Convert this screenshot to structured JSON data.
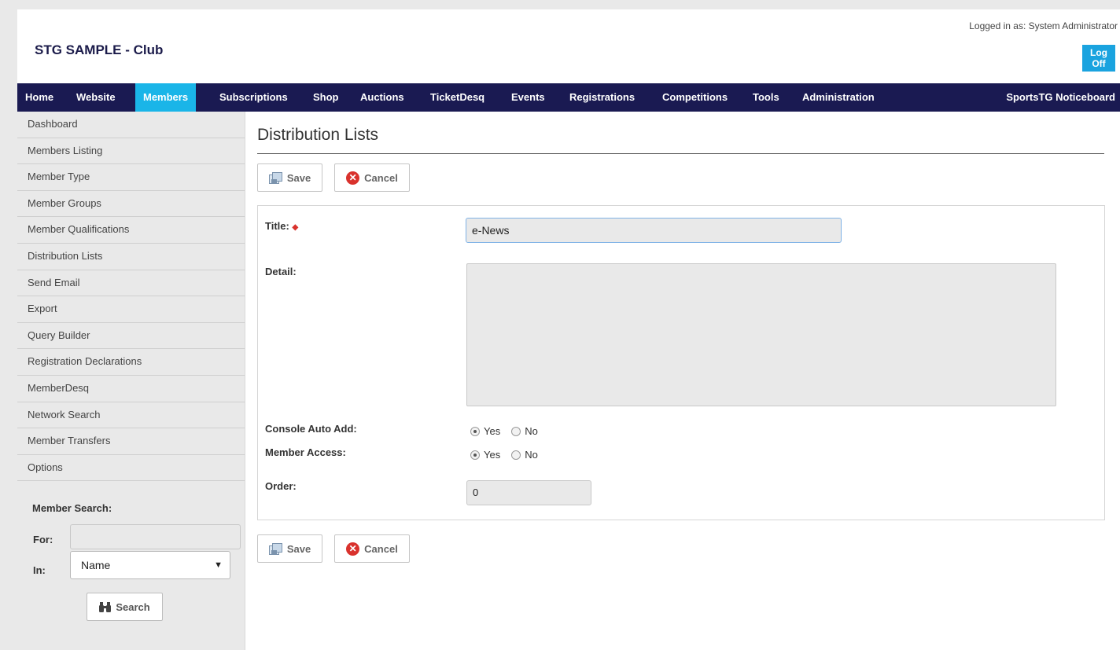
{
  "header": {
    "club_name": "STG SAMPLE - Club",
    "login_text": "Logged in as: System Administrator",
    "logoff_label": "Log Off"
  },
  "nav": {
    "items": [
      "Home",
      "Website",
      "Members",
      "Subscriptions",
      "Shop",
      "Auctions",
      "TicketDesq",
      "Events",
      "Registrations",
      "Competitions",
      "Tools",
      "Administration"
    ],
    "right_item": "SportsTG Noticeboard",
    "active": "Members"
  },
  "sidebar": {
    "items": [
      "Dashboard",
      "Members Listing",
      "Member Type",
      "Member Groups",
      "Member Qualifications",
      "Distribution Lists",
      "Send Email",
      "Export",
      "Query Builder",
      "Registration Declarations",
      "MemberDesq",
      "Network Search",
      "Member Transfers",
      "Options"
    ],
    "search": {
      "heading": "Member Search:",
      "for_label": "For:",
      "for_value": "",
      "in_label": "In:",
      "in_value": "Name",
      "button_label": "Search"
    }
  },
  "main": {
    "page_title": "Distribution Lists",
    "save_label": "Save",
    "cancel_label": "Cancel",
    "form": {
      "title_label": "Title:",
      "title_value": "e-News",
      "detail_label": "Detail:",
      "detail_value": "",
      "console_auto_add_label": "Console Auto Add:",
      "member_access_label": "Member Access:",
      "yes_label": "Yes",
      "no_label": "No",
      "console_auto_add_value": "Yes",
      "member_access_value": "Yes",
      "order_label": "Order:",
      "order_value": "0"
    }
  },
  "colors": {
    "nav_bg": "#1a1a52",
    "nav_active": "#1ab5e8",
    "logoff_bg": "#1aa3df",
    "required": "#d9322d"
  }
}
